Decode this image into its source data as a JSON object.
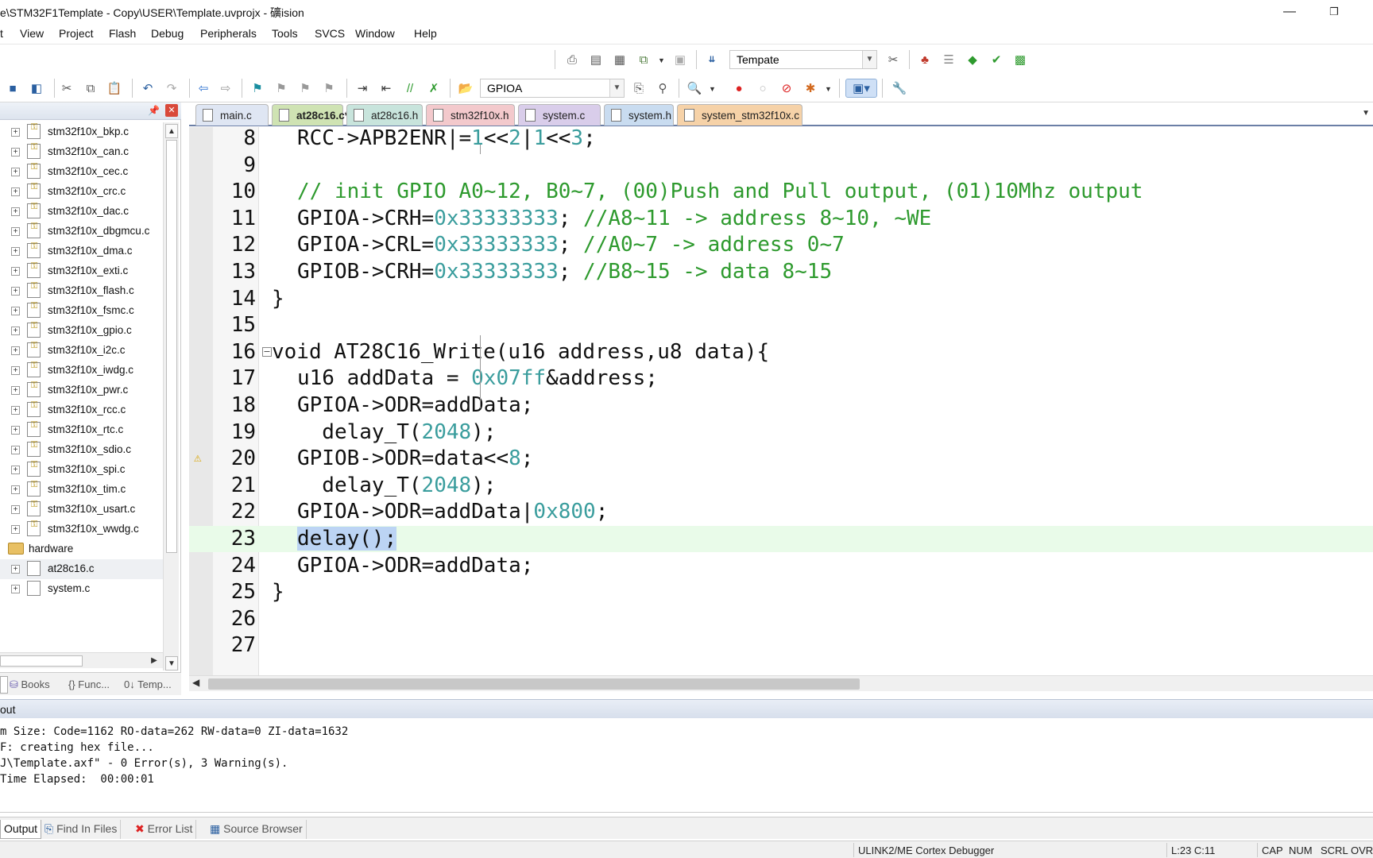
{
  "window": {
    "title": "e\\STM32F1Template - Copy\\USER\\Template.uvprojx - 礦ision",
    "minimize": "—",
    "restore": "❐"
  },
  "menu": [
    "t",
    "View",
    "Project",
    "Flash",
    "Debug",
    "Peripherals",
    "Tools",
    "SVCS",
    "Window",
    "Help"
  ],
  "toolbar": {
    "target_combo": "Tempate",
    "find_combo": "GPIOA"
  },
  "project_panel": {
    "files": [
      "stm32f10x_bkp.c",
      "stm32f10x_can.c",
      "stm32f10x_cec.c",
      "stm32f10x_crc.c",
      "stm32f10x_dac.c",
      "stm32f10x_dbgmcu.c",
      "stm32f10x_dma.c",
      "stm32f10x_exti.c",
      "stm32f10x_flash.c",
      "stm32f10x_fsmc.c",
      "stm32f10x_gpio.c",
      "stm32f10x_i2c.c",
      "stm32f10x_iwdg.c",
      "stm32f10x_pwr.c",
      "stm32f10x_rcc.c",
      "stm32f10x_rtc.c",
      "stm32f10x_sdio.c",
      "stm32f10x_spi.c",
      "stm32f10x_tim.c",
      "stm32f10x_usart.c",
      "stm32f10x_wwdg.c"
    ],
    "group": "hardware",
    "group_files": [
      "at28c16.c",
      "system.c"
    ],
    "bottom_tabs": [
      "Books",
      "{} Func...",
      "0↓ Temp..."
    ]
  },
  "editor_tabs": [
    {
      "label": "main.c",
      "color": "#dfe6f3"
    },
    {
      "label": "at28c16.c*",
      "color": "#cfe3b3"
    },
    {
      "label": "at28c16.h",
      "color": "#c8e4dc"
    },
    {
      "label": "stm32f10x.h",
      "color": "#f3c9cc"
    },
    {
      "label": "system.c",
      "color": "#d9cdea"
    },
    {
      "label": "system.h",
      "color": "#c9dcf0"
    },
    {
      "label": "system_stm32f10x.c",
      "color": "#f6d2a8"
    }
  ],
  "code": {
    "lines": [
      {
        "no": "8",
        "code": "RCC->APB2ENR|=1<<2|1<<3;"
      },
      {
        "no": "9",
        "code": ""
      },
      {
        "no": "10",
        "code": "// init GPIO A0~12, B0~7, (00)Push and Pull output, (01)10Mhz output"
      },
      {
        "no": "11",
        "code": "GPIOA->CRH=0x33333333; //A8~11 -> address 8~10, ~WE"
      },
      {
        "no": "12",
        "code": "GPIOA->CRL=0x33333333; //A0~7 -> address 0~7"
      },
      {
        "no": "13",
        "code": "GPIOB->CRH=0x33333333; //B8~15 -> data 8~15"
      },
      {
        "no": "14",
        "code": "}"
      },
      {
        "no": "15",
        "code": ""
      },
      {
        "no": "16",
        "code": "void AT28C16_Write(u16 address,u8 data){"
      },
      {
        "no": "17",
        "code": "u16 addData = 0x07ff&address;"
      },
      {
        "no": "18",
        "code": "GPIOA->ODR=addData;"
      },
      {
        "no": "19",
        "code": "  delay_T(2048);"
      },
      {
        "no": "20",
        "code": "GPIOB->ODR=data<<8;"
      },
      {
        "no": "21",
        "code": "  delay_T(2048);"
      },
      {
        "no": "22",
        "code": "GPIOA->ODR=addData|0x800;"
      },
      {
        "no": "23",
        "code": "delay();"
      },
      {
        "no": "24",
        "code": "GPIOA->ODR=addData;"
      },
      {
        "no": "25",
        "code": "}"
      },
      {
        "no": "26",
        "code": ""
      },
      {
        "no": "27",
        "code": ""
      }
    ]
  },
  "output": {
    "title": "out",
    "lines": [
      "m Size: Code=1162 RO-data=262 RW-data=0 ZI-data=1632",
      "F: creating hex file...",
      "J\\Template.axf\" - 0 Error(s), 3 Warning(s).",
      "Time Elapsed:  00:00:01"
    ],
    "tabs": [
      "Output",
      "Find In Files",
      "Error List",
      "Source Browser"
    ]
  },
  "status": {
    "debugger": "ULINK2/ME Cortex Debugger",
    "position": "L:23 C:11",
    "caps": "CAP",
    "num": "NUM",
    "scrl": "SCRL",
    "ovr": "OVR"
  }
}
